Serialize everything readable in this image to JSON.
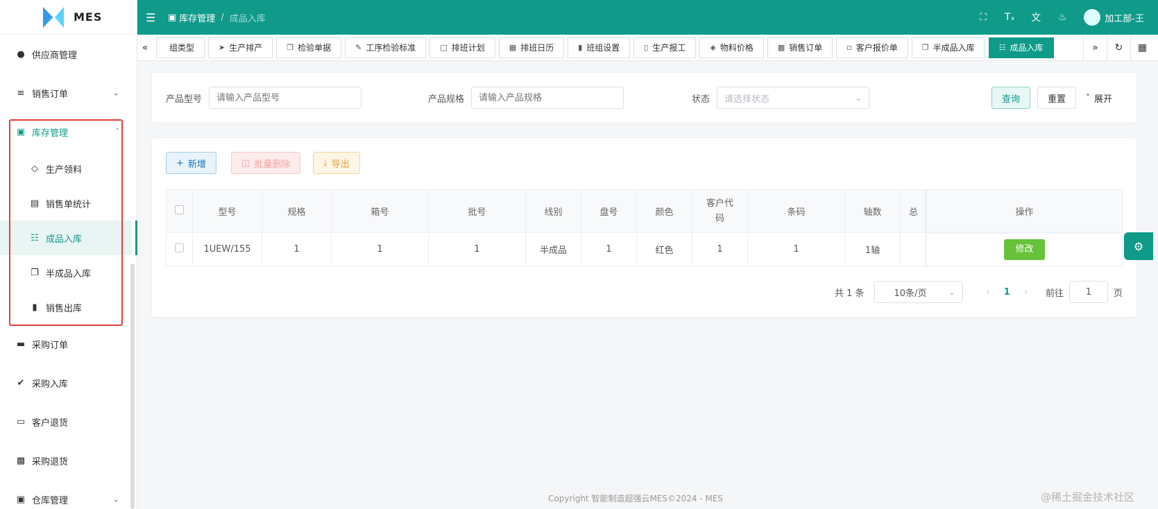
{
  "app": {
    "logo_text": "MES"
  },
  "sidebar": {
    "items_top": [
      {
        "label": "供应商管理",
        "icon": "user-icon"
      },
      {
        "label": "销售订单",
        "icon": "list-check-icon",
        "has_chevron": true
      }
    ],
    "inventory": {
      "label": "库存管理",
      "children": [
        {
          "label": "生产领料",
          "icon": "diamond-icon"
        },
        {
          "label": "销售单统计",
          "icon": "document-icon"
        },
        {
          "label": "成品入库",
          "icon": "barcode-icon",
          "active": true
        },
        {
          "label": "半成品入库",
          "icon": "copy-icon"
        },
        {
          "label": "销售出库",
          "icon": "file-export-icon"
        }
      ]
    },
    "items_bottom": [
      {
        "label": "采购订单",
        "icon": "briefcase-icon"
      },
      {
        "label": "采购入库",
        "icon": "double-check-icon"
      },
      {
        "label": "客户退货",
        "icon": "inbox-icon"
      },
      {
        "label": "采购退货",
        "icon": "ticket-icon"
      },
      {
        "label": "仓库管理",
        "icon": "warehouse-icon",
        "has_chevron": true
      }
    ]
  },
  "header": {
    "breadcrumb_1": "库存管理",
    "breadcrumb_sep": "/",
    "breadcrumb_2": "成品入库",
    "user_name": "加工部-王"
  },
  "tabs": [
    {
      "label": "组类型",
      "icon": ""
    },
    {
      "label": "生产排产",
      "icon": "send-icon"
    },
    {
      "label": "检验单据",
      "icon": "copy-icon"
    },
    {
      "label": "工序检验标准",
      "icon": "edit-icon"
    },
    {
      "label": "排班计划",
      "icon": "message-icon"
    },
    {
      "label": "排班日历",
      "icon": "calendar-icon"
    },
    {
      "label": "班组设置",
      "icon": "book-icon"
    },
    {
      "label": "生产报工",
      "icon": "tablet-icon"
    },
    {
      "label": "物料价格",
      "icon": "tag-icon"
    },
    {
      "label": "销售订单",
      "icon": "box-icon"
    },
    {
      "label": "客户报价单",
      "icon": "clipboard-icon"
    },
    {
      "label": "半成品入库",
      "icon": "copy-icon"
    },
    {
      "label": "成品入库",
      "icon": "barcode-icon",
      "active": true
    }
  ],
  "search": {
    "model_label": "产品型号",
    "model_placeholder": "请输入产品型号",
    "spec_label": "产品规格",
    "spec_placeholder": "请输入产品规格",
    "status_label": "状态",
    "status_placeholder": "请选择状态",
    "query_label": "查询",
    "reset_label": "重置",
    "expand_label": "展开"
  },
  "toolbar": {
    "add_label": "新增",
    "batch_delete_label": "批量删除",
    "export_label": "导出"
  },
  "table": {
    "columns": [
      "型号",
      "规格",
      "箱号",
      "批号",
      "线别",
      "盘号",
      "颜色",
      "客户代码",
      "条码",
      "轴数",
      "总",
      "操作"
    ],
    "rows": [
      {
        "cells": [
          "1UEW/155",
          "1",
          "1",
          "1",
          "半成品",
          "1",
          "红色",
          "1",
          "1",
          "1轴",
          ""
        ],
        "action": "修改"
      }
    ]
  },
  "pagination": {
    "total": "共 1 条",
    "page_size": "10条/页",
    "current": "1",
    "goto_label": "前往",
    "goto_value": "1",
    "page_suffix": "页"
  },
  "footer": {
    "copyright": "Copyright 智能制造超强云MES©2024 - MES"
  },
  "watermark": "@稀土掘金技术社区",
  "colors": {
    "primary": "#0f9a8a",
    "highlight": "#e23b3b",
    "edit_button": "#67c23a"
  }
}
